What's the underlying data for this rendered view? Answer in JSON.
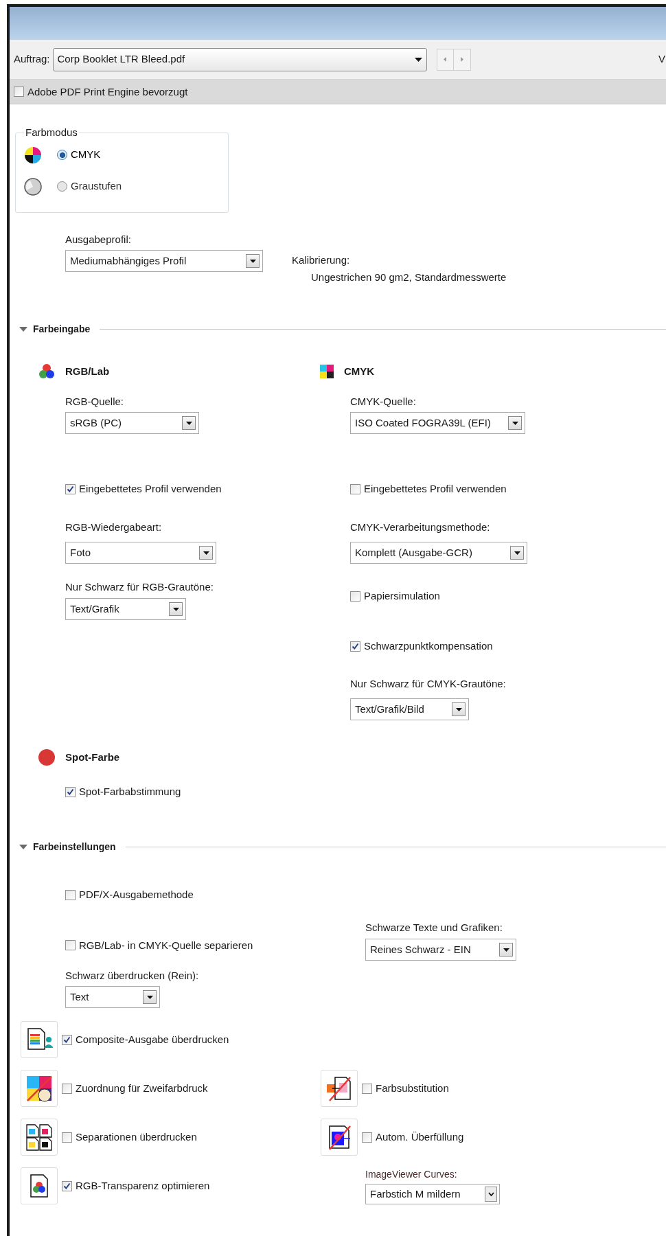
{
  "toolbar": {
    "job_label": "Auftrag:",
    "job_value": "Corp Booklet LTR Bleed.pdf",
    "cut_text": "V"
  },
  "engine_option": {
    "label": "Adobe PDF Print Engine bevorzugt",
    "checked": false
  },
  "color_mode": {
    "title": "Farbmodus",
    "options": [
      {
        "label": "CMYK",
        "selected": true,
        "kind": "cmyk"
      },
      {
        "label": "Graustufen",
        "selected": false,
        "kind": "gray"
      }
    ]
  },
  "output_profile": {
    "label": "Ausgabeprofil:",
    "value": "Mediumabhängiges Profil"
  },
  "calibration": {
    "label": "Kalibrierung:",
    "value": "Ungestrichen 90 gm2, Standardmesswerte"
  },
  "color_input": {
    "title": "Farbeingabe",
    "expanded": true,
    "rgb": {
      "title": "RGB/Lab",
      "source_label": "RGB-Quelle:",
      "source_value": "sRGB (PC)",
      "embedded": {
        "label": "Eingebettetes Profil verwenden",
        "checked": true
      },
      "rendering_label": "RGB-Wiedergabeart:",
      "rendering_value": "Foto",
      "black_only_label": "Nur Schwarz für RGB-Grautöne:",
      "black_only_value": "Text/Grafik"
    },
    "cmyk": {
      "title": "CMYK",
      "source_label": "CMYK-Quelle:",
      "source_value": "ISO Coated FOGRA39L (EFI)",
      "embedded": {
        "label": "Eingebettetes Profil verwenden",
        "checked": false
      },
      "method_label": "CMYK-Verarbeitungsmethode:",
      "method_value": "Komplett (Ausgabe-GCR)",
      "paper_sim": {
        "label": "Papiersimulation",
        "checked": false
      },
      "black_point": {
        "label": "Schwarzpunktkompensation",
        "checked": true
      },
      "black_only_label": "Nur Schwarz für CMYK-Grautöne:",
      "black_only_value": "Text/Grafik/Bild"
    },
    "spot": {
      "title": "Spot-Farbe",
      "matching": {
        "label": "Spot-Farbabstimmung",
        "checked": true
      }
    }
  },
  "color_settings": {
    "title": "Farbeinstellungen",
    "expanded": true,
    "pdfx": {
      "label": "PDF/X-Ausgabemethode",
      "checked": false
    },
    "separate": {
      "label": "RGB/Lab- in CMYK-Quelle separieren",
      "checked": false
    },
    "black_text_label": "Schwarze Texte und Grafiken:",
    "black_text_value": "Reines Schwarz - EIN",
    "overprint_black_label": "Schwarz überdrucken (Rein):",
    "overprint_black_value": "Text",
    "option_rows": [
      {
        "items": [
          {
            "kind": "composite",
            "label": "Composite-Ausgabe überdrucken",
            "checked": true
          }
        ]
      },
      {
        "items": [
          {
            "kind": "duotone",
            "label": "Zuordnung für Zweifarbdruck",
            "checked": false
          },
          {
            "kind": "substitution",
            "label": "Farbsubstitution",
            "checked": false
          }
        ]
      },
      {
        "items": [
          {
            "kind": "separations",
            "label": "Separationen überdrucken",
            "checked": false
          },
          {
            "kind": "trapping",
            "label": "Autom. Überfüllung",
            "checked": false
          }
        ]
      },
      {
        "items": [
          {
            "kind": "transparency",
            "label": "RGB-Transparenz optimieren",
            "checked": true
          }
        ]
      }
    ],
    "curves_label": "ImageViewer Curves:",
    "curves_value": "Farbstich M mildern"
  }
}
